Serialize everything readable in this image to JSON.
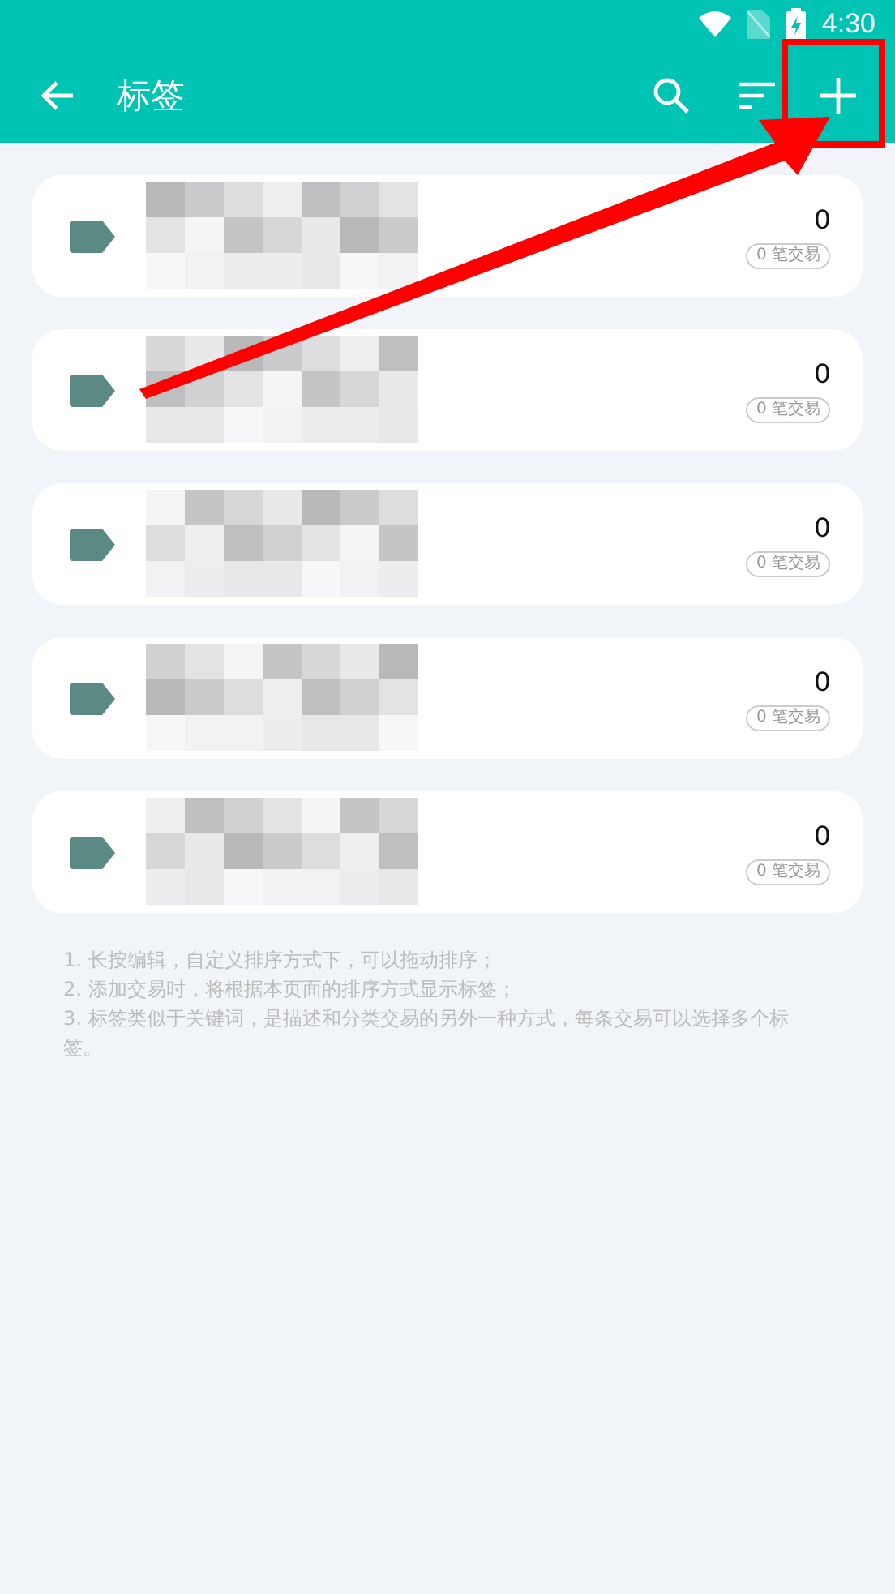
{
  "status_bar": {
    "time": "4:30"
  },
  "app_bar": {
    "title": "标签"
  },
  "tags": [
    {
      "count": "0",
      "transactions": "0 笔交易"
    },
    {
      "count": "0",
      "transactions": "0 笔交易"
    },
    {
      "count": "0",
      "transactions": "0 笔交易"
    },
    {
      "count": "0",
      "transactions": "0 笔交易"
    },
    {
      "count": "0",
      "transactions": "0 笔交易"
    }
  ],
  "notes": [
    "1. 长按编辑，自定义排序方式下，可以拖动排序；",
    "2. 添加交易时，将根据本页面的排序方式显示标签；",
    "3. 标签类似于关键词，是描述和分类交易的另外一种方式，每条交易可以选择多个标签。"
  ]
}
